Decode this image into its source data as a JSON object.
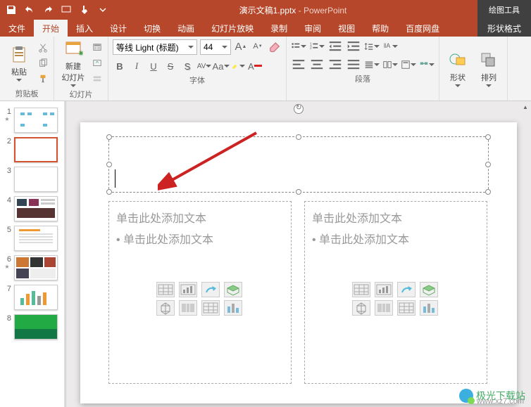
{
  "titlebar": {
    "doc_name": "演示文稿1.pptx",
    "app_name": "PowerPoint",
    "contextual": "绘图工具"
  },
  "tabs": {
    "file": "文件",
    "home": "开始",
    "insert": "插入",
    "design": "设计",
    "transitions": "切换",
    "animations": "动画",
    "slideshow": "幻灯片放映",
    "record": "录制",
    "review": "审阅",
    "view": "视图",
    "help": "帮助",
    "baidu": "百度网盘",
    "format": "形状格式"
  },
  "ribbon": {
    "clipboard": {
      "paste": "粘贴",
      "label": "剪贴板"
    },
    "slides": {
      "new": "新建\n幻灯片",
      "label": "幻灯片"
    },
    "font": {
      "name": "等线 Light (标题)",
      "size": "44",
      "label": "字体"
    },
    "paragraph": {
      "label": "段落"
    },
    "shapes": {
      "shape": "形状",
      "arrange": "排列"
    }
  },
  "slides": [
    {
      "num": "1"
    },
    {
      "num": "2"
    },
    {
      "num": "3"
    },
    {
      "num": "4"
    },
    {
      "num": "5"
    },
    {
      "num": "6"
    },
    {
      "num": "7"
    },
    {
      "num": "8"
    }
  ],
  "placeholder": {
    "add_text": "单击此处添加文本",
    "bullet_add": "单击此处添加文本"
  },
  "watermark": {
    "line1": "极光下载站",
    "line2": "www.xz7.com"
  }
}
